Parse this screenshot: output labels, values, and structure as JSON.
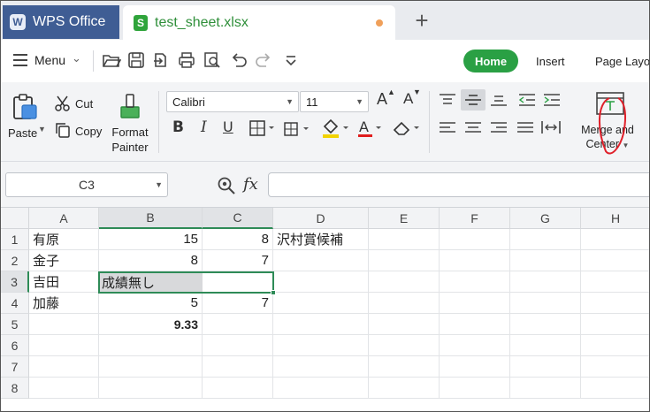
{
  "tabs": {
    "app_label": "WPS Office",
    "app_logo_letter": "W",
    "file_label": "test_sheet.xlsx",
    "file_logo_letter": "S",
    "new_tab_label": "+"
  },
  "menu": {
    "menu_label": "Menu",
    "home_label": "Home",
    "insert_label": "Insert",
    "layout_label": "Page Layout"
  },
  "ribbon": {
    "paste_label": "Paste",
    "cut_label": "Cut",
    "copy_label": "Copy",
    "format_painter_line1": "Format",
    "format_painter_line2": "Painter",
    "font_name": "Calibri",
    "font_size": "11",
    "bold_label": "B",
    "italic_label": "I",
    "underline_label": "U",
    "grow_label": "A",
    "shrink_label": "A",
    "merge_line1": "Merge and",
    "merge_line2": "Center"
  },
  "formula_bar": {
    "name_box": "C3",
    "fx_label": "fx",
    "formula": ""
  },
  "sheet": {
    "columns": [
      "A",
      "B",
      "C",
      "D",
      "E",
      "F",
      "G",
      "H"
    ],
    "rows": [
      "1",
      "2",
      "3",
      "4",
      "5",
      "6",
      "7",
      "8"
    ],
    "cells": {
      "A1": "有原",
      "B1": "15",
      "C1": "8",
      "D1": "沢村賞候補",
      "A2": "金子",
      "B2": "8",
      "C2": "7",
      "A3": "吉田",
      "B3": "成績無し",
      "A4": "加藤",
      "B4": "5",
      "C4": "7",
      "B5": "9.33"
    },
    "active_cell": "C3"
  },
  "colors": {
    "accent_green": "#2aa044",
    "selection_green": "#2e8b57",
    "wps_tab_blue": "#3f5d94",
    "annotation_red": "#e0202a"
  }
}
